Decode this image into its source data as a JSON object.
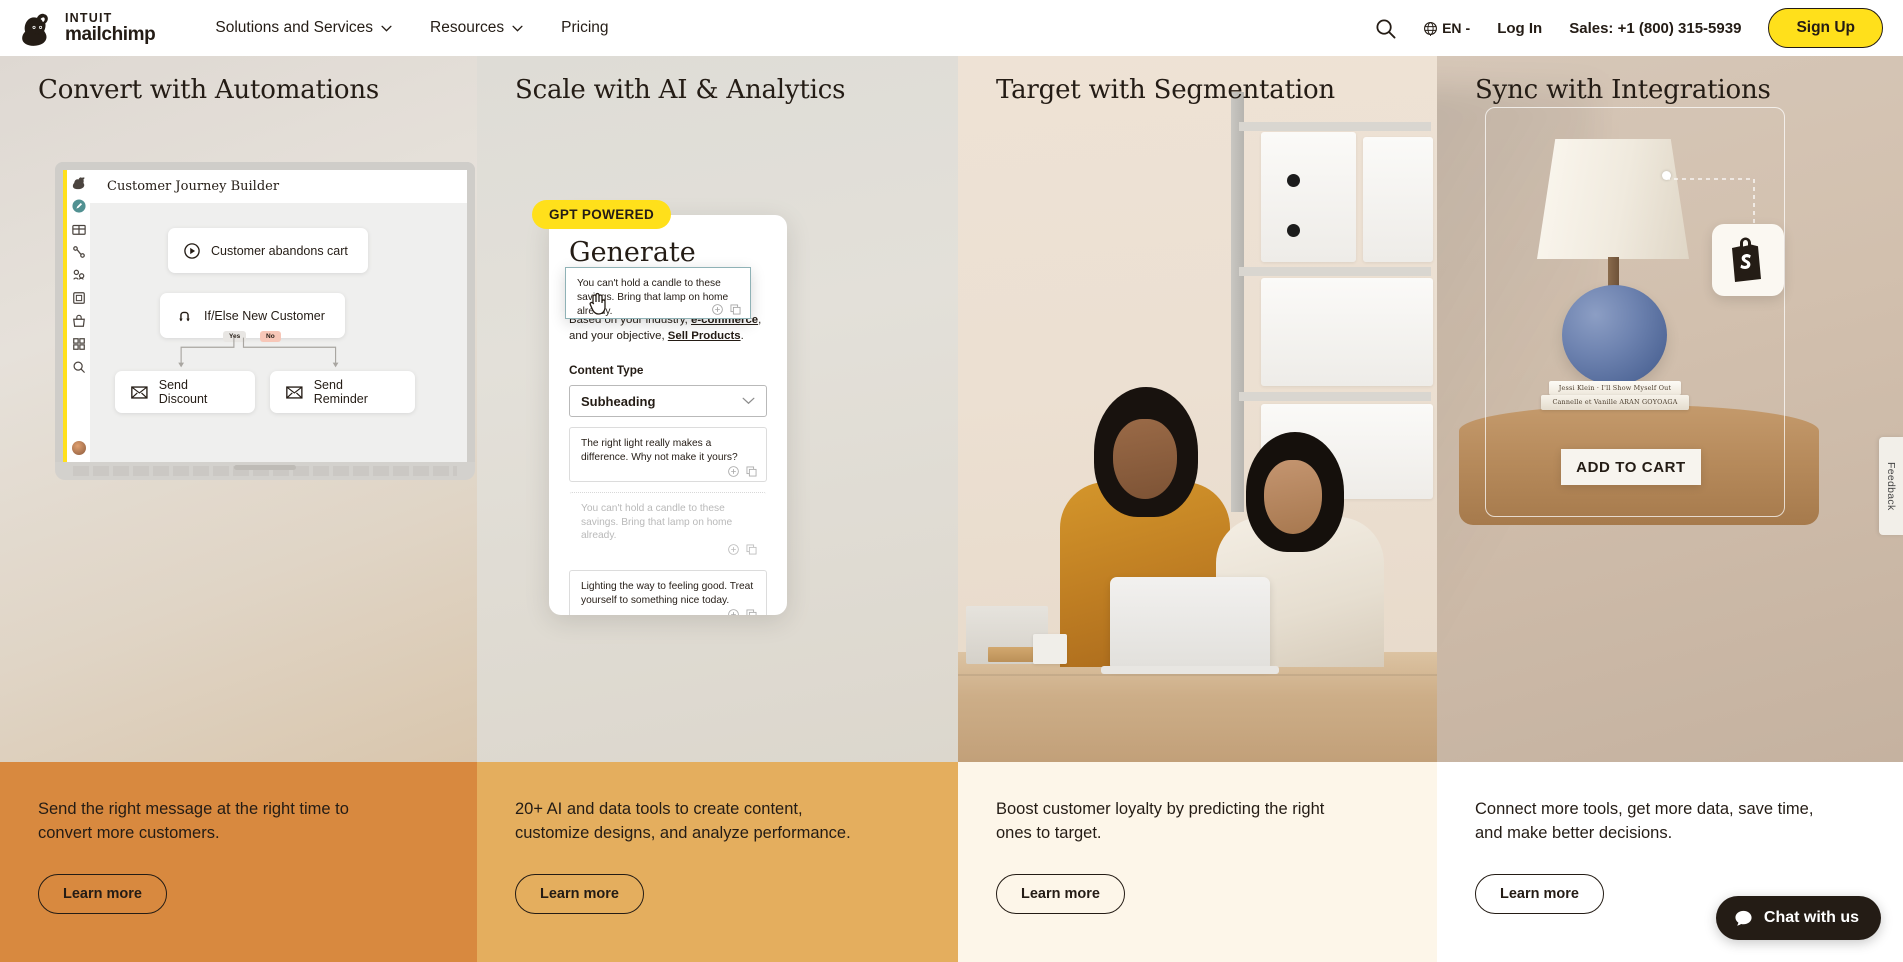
{
  "header": {
    "logo": {
      "line1": "INTUIT",
      "line2": "mailchimp",
      "icon": "mailchimp-freddie-icon"
    },
    "nav": [
      {
        "label": "Solutions and Services",
        "has_dropdown": true
      },
      {
        "label": "Resources",
        "has_dropdown": true
      },
      {
        "label": "Pricing",
        "has_dropdown": false
      }
    ],
    "search_icon": "search-icon",
    "language": {
      "code": "EN",
      "caret": "-",
      "icon": "globe-icon"
    },
    "login_label": "Log In",
    "sales_label": "Sales: +1 (800) 315-5939",
    "signup_label": "Sign Up"
  },
  "colors": {
    "brand_yellow": "#ffe01b",
    "ink": "#241c15",
    "panel1_bg": "#d8893f",
    "panel2_bg": "#e4ae5e",
    "panel3_bg": "#fdf6e9",
    "panel4_bg": "#ffffff"
  },
  "panels": [
    {
      "title": "Convert with Automations",
      "caption": "Send the right message at the right time to convert more customers.",
      "cta": "Learn more"
    },
    {
      "title": "Scale with AI & Analytics",
      "caption": "20+ AI and data tools to create content, customize designs, and analyze performance.",
      "cta": "Learn more"
    },
    {
      "title": "Target with Segmentation",
      "caption": "Boost customer loyalty by predicting the right ones to target.",
      "cta": "Learn more"
    },
    {
      "title": "Sync with Integrations",
      "caption": "Connect more tools, get more data, save time, and make better decisions.",
      "cta": "Learn more"
    }
  ],
  "journey_builder": {
    "app_title": "Customer Journey Builder",
    "nodes": [
      {
        "label": "Customer abandons cart",
        "icon": "play-circle-icon"
      },
      {
        "label": "If/Else New Customer",
        "icon": "branch-icon"
      },
      {
        "label": "Send Discount",
        "icon": "envelope-icon"
      },
      {
        "label": "Send Reminder",
        "icon": "envelope-icon"
      }
    ],
    "branch_yes": "Yes",
    "branch_no": "No"
  },
  "generate_email": {
    "badge": "GPT POWERED",
    "title": "Generate Email",
    "sub_prefix": "Based on your industry,",
    "sub_industry": "e-commerce",
    "sub_mid": ", and your objective,",
    "sub_objective": "Sell Products",
    "sub_suffix": ".",
    "content_type_label": "Content Type",
    "content_type_value": "Subheading",
    "suggestion_1": "The right light really makes a difference. Why not make it yours?",
    "suggestion_2": "You can't hold a candle to these savings. Bring that lamp on home already.",
    "suggestion_3": "Lighting the way to feeling good. Treat yourself to something nice today.",
    "dragged_card": "You can't hold a candle to these savings. Bring that lamp on home already.",
    "action_add_icon": "plus-circle-icon",
    "action_copy_icon": "copy-icon",
    "cursor_icon": "grab-hand-cursor-icon"
  },
  "product_card": {
    "add_to_cart": "ADD TO CART",
    "integration_icon": "shopify-bag-icon",
    "book_1": "Jessi Klein  ·  I'll Show Myself Out",
    "book_2": "Cannelle et Vanille            ARAN GOYOAGA"
  },
  "overlays": {
    "feedback_label": "Feedback",
    "chat_label": "Chat with us",
    "chat_icon": "chat-bubble-icon"
  }
}
